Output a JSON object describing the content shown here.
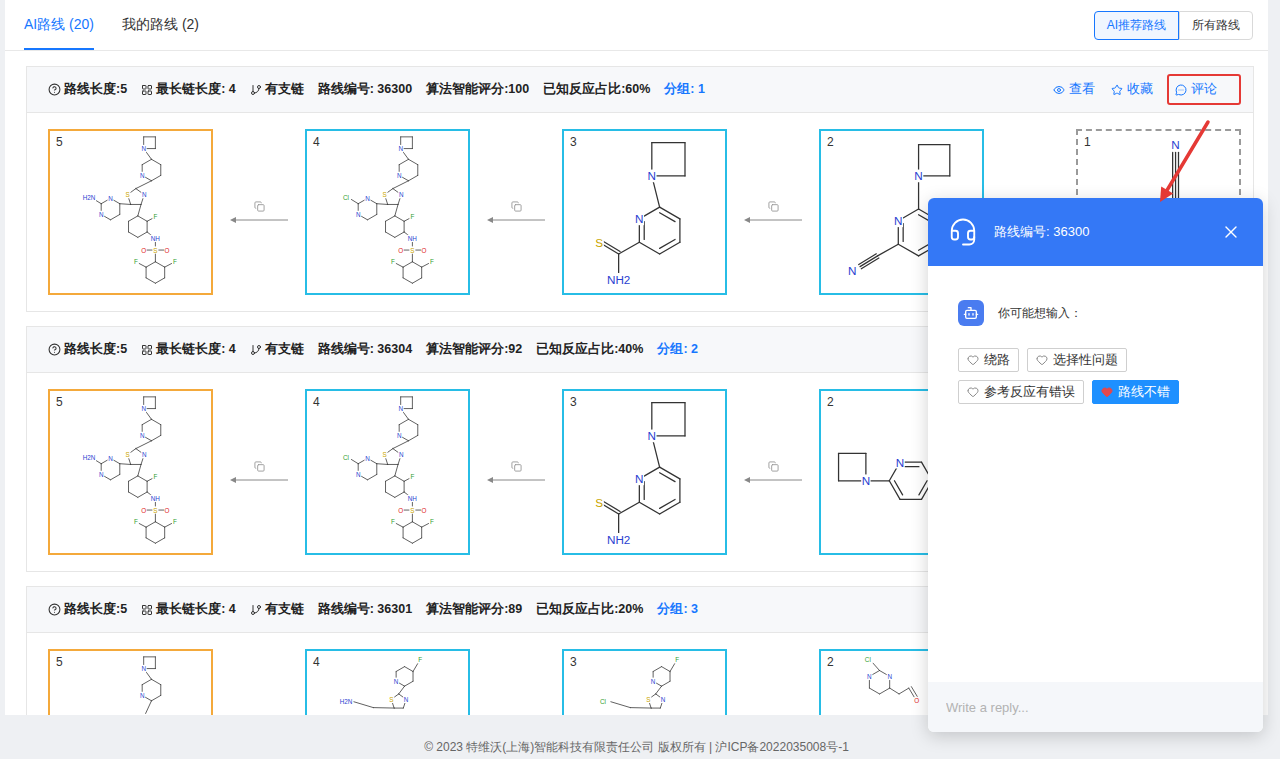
{
  "tabs": [
    {
      "label": "AI路线 (20)",
      "selected": true
    },
    {
      "label": "我的路线 (2)",
      "selected": false
    }
  ],
  "view_toggle": [
    {
      "label": "AI推荐路线",
      "selected": true
    },
    {
      "label": "所有路线",
      "selected": false
    }
  ],
  "routes": [
    {
      "route_length": "路线长度:5",
      "longest_chain": "最长链长度: 4",
      "branch": "有支链",
      "route_id": "路线编号: 36300",
      "score": "算法智能评分:100",
      "known_ratio": "已知反应占比:60%",
      "group": "分组: 1",
      "actions": [
        {
          "label": "查看",
          "kind": "view",
          "highlighted": false
        },
        {
          "label": "收藏",
          "kind": "favorite",
          "highlighted": false
        },
        {
          "label": "评论",
          "kind": "comment",
          "highlighted": true
        }
      ],
      "molecules": [
        {
          "number": "5",
          "target": true,
          "starting_material": false,
          "kind": "biaryl",
          "atoms": [
            "N",
            "N",
            "S",
            "N",
            "N",
            "N",
            "H2N",
            "F",
            "NH",
            "O",
            "S",
            "O",
            "F",
            "F"
          ]
        },
        {
          "number": "4",
          "target": false,
          "starting_material": false,
          "kind": "biaryl",
          "atoms": [
            "N",
            "N",
            "S",
            "N",
            "N",
            "N",
            "Cl",
            "F",
            "NH",
            "O",
            "S",
            "O",
            "F",
            "F"
          ]
        },
        {
          "number": "3",
          "target": false,
          "starting_material": false,
          "kind": "thioamide",
          "atoms": [
            "N",
            "N",
            "S",
            "NH2"
          ]
        },
        {
          "number": "2",
          "target": false,
          "starting_material": false,
          "kind": "nitrile-pyrimidine",
          "atoms": [
            "N",
            "N",
            "N"
          ]
        },
        {
          "number": "1",
          "target": false,
          "starting_material": true,
          "kind": "nitrile",
          "atoms": [
            "N"
          ]
        }
      ]
    },
    {
      "route_length": "路线长度:5",
      "longest_chain": "最长链长度: 4",
      "branch": "有支链",
      "route_id": "路线编号: 36304",
      "score": "算法智能评分:92",
      "known_ratio": "已知反应占比:40%",
      "group": "分组: 2",
      "actions": [],
      "molecules": [
        {
          "number": "5",
          "target": true,
          "starting_material": false,
          "kind": "biaryl",
          "atoms": [
            "N",
            "N",
            "S",
            "N",
            "N",
            "N",
            "H2N",
            "F",
            "NH",
            "O",
            "S",
            "O",
            "F",
            "F"
          ]
        },
        {
          "number": "4",
          "target": false,
          "starting_material": false,
          "kind": "biaryl",
          "atoms": [
            "N",
            "N",
            "S",
            "N",
            "N",
            "N",
            "Cl",
            "F",
            "NH",
            "O",
            "S",
            "O",
            "F",
            "F"
          ]
        },
        {
          "number": "3",
          "target": false,
          "starting_material": false,
          "kind": "thioamide",
          "atoms": [
            "N",
            "N",
            "S",
            "NH2"
          ]
        },
        {
          "number": "2",
          "target": false,
          "starting_material": false,
          "kind": "azetidine-pyridine",
          "atoms": [
            "N",
            "N"
          ]
        }
      ]
    },
    {
      "route_length": "路线长度:5",
      "longest_chain": "最长链长度: 4",
      "branch": "有支链",
      "route_id": "路线编号: 36301",
      "score": "算法智能评分:89",
      "known_ratio": "已知反应占比:20%",
      "group": "分组: 3",
      "actions": [],
      "molecules": [
        {
          "number": "5",
          "target": true,
          "starting_material": false,
          "kind": "product-top",
          "atoms": [
            "N",
            "N"
          ]
        },
        {
          "number": "4",
          "target": false,
          "starting_material": false,
          "kind": "fluoropyridine",
          "atoms": [
            "F",
            "N",
            "S",
            "N",
            "H2N"
          ]
        },
        {
          "number": "3",
          "target": false,
          "starting_material": false,
          "kind": "fluoropyridine",
          "atoms": [
            "F",
            "N",
            "S",
            "N",
            "Cl"
          ]
        },
        {
          "number": "2",
          "target": false,
          "starting_material": false,
          "kind": "chloropyrimidine",
          "atoms": [
            "Cl",
            "N",
            "N",
            "O"
          ]
        }
      ]
    }
  ],
  "comment_panel": {
    "title": "路线编号: 36300",
    "prompt": "你可能想输入：",
    "chips": [
      {
        "label": "绕路",
        "selected": false
      },
      {
        "label": "选择性问题",
        "selected": false
      },
      {
        "label": "参考反应有错误",
        "selected": false
      },
      {
        "label": "路线不错",
        "selected": true
      }
    ],
    "input_placeholder": "Write a reply..."
  },
  "footer": "© 2023 特维沃(上海)智能科技有限责任公司 版权所有 | 沪ICP备2022035008号-1"
}
